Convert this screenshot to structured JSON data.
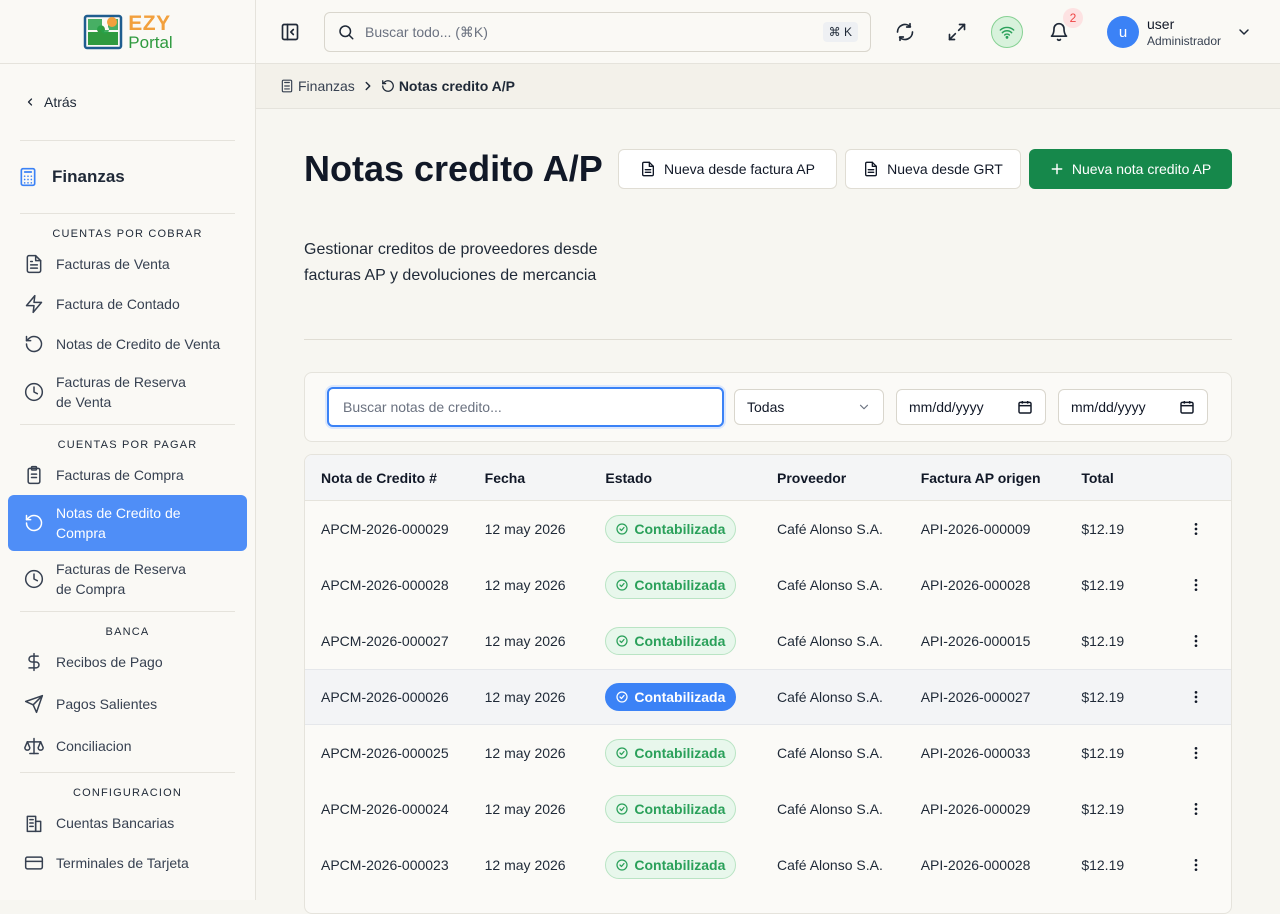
{
  "logo": {
    "brand": "EZY",
    "product": "Portal"
  },
  "sidebar": {
    "back_label": "Atrás",
    "module_label": "Finanzas",
    "sections": [
      {
        "title": "CUENTAS POR COBRAR"
      },
      {
        "title": "CUENTAS POR PAGAR"
      },
      {
        "title": "BANCA"
      },
      {
        "title": "CONFIGURACION"
      }
    ],
    "items": [
      {
        "label": "Facturas de Venta",
        "icon": "file-text-icon"
      },
      {
        "label": "Factura de Contado",
        "icon": "zap-icon"
      },
      {
        "label": "Notas de Credito de Venta",
        "icon": "rotate-ccw-icon"
      },
      {
        "label": "Facturas de Reserva de Venta",
        "icon": "clock-icon"
      },
      {
        "label": "Facturas de Compra",
        "icon": "clipboard-icon"
      },
      {
        "label": "Notas de Credito de Compra",
        "icon": "rotate-ccw-icon",
        "active": true
      },
      {
        "label": "Facturas de Reserva de Compra",
        "icon": "clock-icon"
      },
      {
        "label": "Recibos de Pago",
        "icon": "dollar-icon"
      },
      {
        "label": "Pagos Salientes",
        "icon": "send-icon"
      },
      {
        "label": "Conciliacion",
        "icon": "scale-icon"
      },
      {
        "label": "Cuentas Bancarias",
        "icon": "bank-icon"
      },
      {
        "label": "Terminales de Tarjeta",
        "icon": "credit-card-icon"
      }
    ]
  },
  "topbar": {
    "search_placeholder": "Buscar todo... (⌘K)",
    "shortcut": "⌘ K",
    "notification_count": "2",
    "avatar_initial": "u",
    "user_name": "user",
    "user_role": "Administrador"
  },
  "breadcrumb": {
    "parent": "Finanzas",
    "current": "Notas credito A/P"
  },
  "page": {
    "title": "Notas credito A/P",
    "subtitle": "Gestionar creditos de proveedores desde facturas AP y devoluciones de mercancia",
    "btn_from_invoice": "Nueva desde factura AP",
    "btn_from_grt": "Nueva desde GRT",
    "btn_new": "Nueva nota credito AP"
  },
  "filters": {
    "search_placeholder": "Buscar notas de credito...",
    "status_value": "Todas",
    "date_from": "mm/dd/yyyy",
    "date_to": "mm/dd/yyyy"
  },
  "table": {
    "headers": [
      "Nota de Credito #",
      "Fecha",
      "Estado",
      "Proveedor",
      "Factura AP origen",
      "Total"
    ],
    "rows": [
      {
        "number": "APCM-2026-000029",
        "date": "12 may 2026",
        "status": "Contabilizada",
        "vendor": "Café Alonso S.A.",
        "source": "API-2026-000009",
        "total": "$12.19"
      },
      {
        "number": "APCM-2026-000028",
        "date": "12 may 2026",
        "status": "Contabilizada",
        "vendor": "Café Alonso S.A.",
        "source": "API-2026-000028",
        "total": "$12.19"
      },
      {
        "number": "APCM-2026-000027",
        "date": "12 may 2026",
        "status": "Contabilizada",
        "vendor": "Café Alonso S.A.",
        "source": "API-2026-000015",
        "total": "$12.19"
      },
      {
        "number": "APCM-2026-000026",
        "date": "12 may 2026",
        "status": "Contabilizada",
        "vendor": "Café Alonso S.A.",
        "source": "API-2026-000027",
        "total": "$12.19"
      },
      {
        "number": "APCM-2026-000025",
        "date": "12 may 2026",
        "status": "Contabilizada",
        "vendor": "Café Alonso S.A.",
        "source": "API-2026-000033",
        "total": "$12.19"
      },
      {
        "number": "APCM-2026-000024",
        "date": "12 may 2026",
        "status": "Contabilizada",
        "vendor": "Café Alonso S.A.",
        "source": "API-2026-000029",
        "total": "$12.19"
      },
      {
        "number": "APCM-2026-000023",
        "date": "12 may 2026",
        "status": "Contabilizada",
        "vendor": "Café Alonso S.A.",
        "source": "API-2026-000028",
        "total": "$12.19"
      }
    ]
  },
  "colors": {
    "accent": "#3b82f6",
    "primary_button": "#16884b",
    "status_green": "#2aa05a"
  }
}
